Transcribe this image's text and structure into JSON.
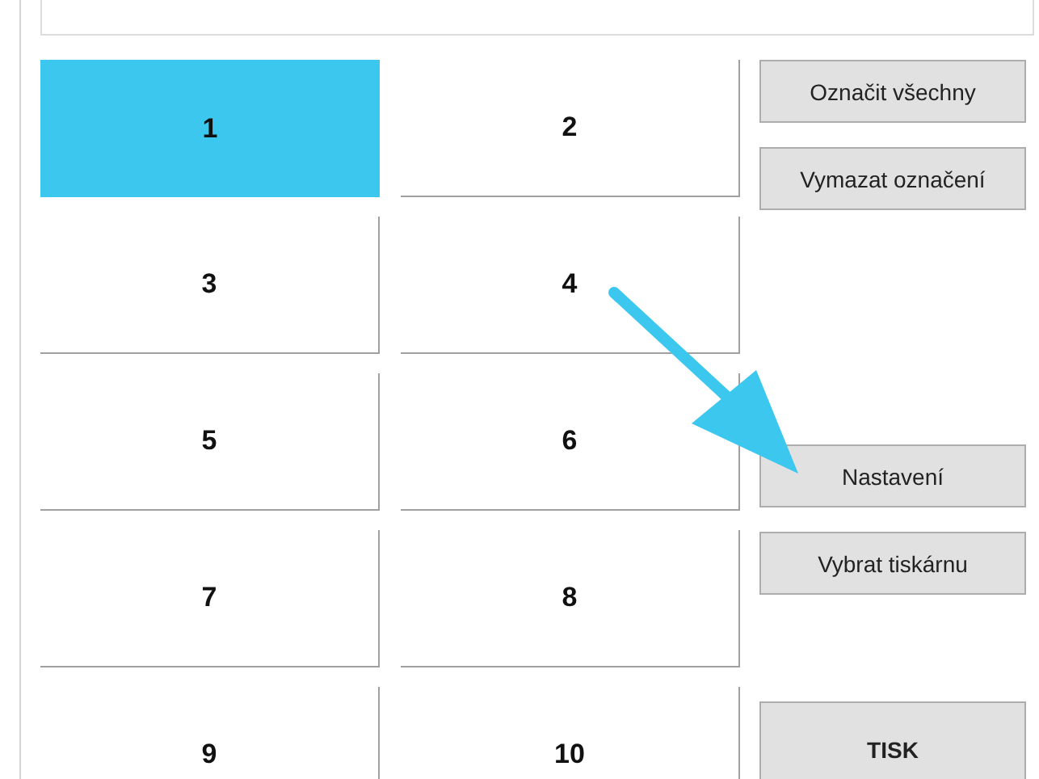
{
  "tiles": [
    {
      "label": "1",
      "selected": true
    },
    {
      "label": "2",
      "selected": false
    },
    {
      "label": "3",
      "selected": false
    },
    {
      "label": "4",
      "selected": false
    },
    {
      "label": "5",
      "selected": false
    },
    {
      "label": "6",
      "selected": false
    },
    {
      "label": "7",
      "selected": false
    },
    {
      "label": "8",
      "selected": false
    },
    {
      "label": "9",
      "selected": false
    },
    {
      "label": "10",
      "selected": false
    }
  ],
  "buttons": [
    {
      "label": "Označit všechny",
      "kind": "normal"
    },
    {
      "label": "Vymazat označení",
      "kind": "normal"
    },
    {
      "label": "Nastavení",
      "kind": "normal"
    },
    {
      "label": "Vybrat tiskárnu",
      "kind": "normal"
    },
    {
      "label": "TISK",
      "kind": "primary"
    }
  ]
}
